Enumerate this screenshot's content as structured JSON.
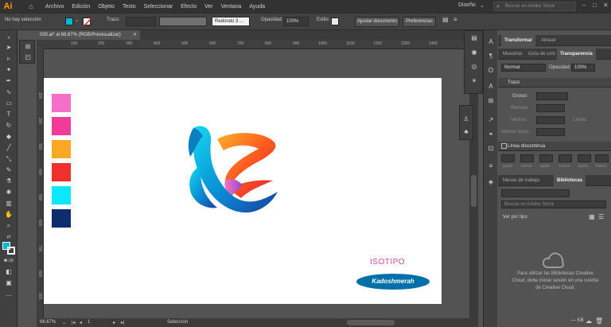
{
  "menubar": {
    "logo": "Ai",
    "home_icon": "home-icon",
    "items": [
      "Archivo",
      "Edición",
      "Objeto",
      "Texto",
      "Seleccionar",
      "Efecto",
      "Ver",
      "Ventana",
      "Ayuda"
    ],
    "workspace": "Diseño",
    "stock_search_placeholder": "Buscar en Adobe Stock",
    "window_minimize": "–",
    "window_maximize": "□",
    "window_close": "✕"
  },
  "controlbar": {
    "selection_status": "No hay selección",
    "stroke_label": "Trazo:",
    "brush_label": "Redondo 3 ...",
    "opacity_label": "Opacidad:",
    "opacity_value": "100%",
    "style_label": "Estilo:",
    "fit_document_button": "Ajustar documento",
    "preferences_button": "Preferencias",
    "fill_color": "#00b7d6"
  },
  "document": {
    "tab_title": "030.ai* al 66,67% (RGB/Previsualizar)",
    "close_icon": "close-icon"
  },
  "rulers": {
    "top_ticks": [
      "100",
      "200",
      "300",
      "400",
      "500",
      "600",
      "700",
      "800",
      "900",
      "1000",
      "1100",
      "1200",
      "1300",
      "1400"
    ],
    "left_ticks": [
      "100",
      "200",
      "300",
      "400",
      "500",
      "600",
      "700",
      "800",
      "900",
      "1000"
    ]
  },
  "artboard": {
    "swatches": [
      "#f56fc8",
      "#f23b98",
      "#f8a824",
      "#f02f2f",
      "#0ee6fa",
      "#0c2d6e"
    ],
    "isotipo_label": "ISOTIPO",
    "brand_name": "Kadoshmerah",
    "brand_color": "#0071a8"
  },
  "statusbar": {
    "zoom": "66,67%",
    "artboard_number": "1",
    "tool_name": "Selección"
  },
  "rightpanel": {
    "tabs_top": [
      "Transformar",
      "Alinear"
    ],
    "tabs_second": [
      "Muestras",
      "Guía de colo",
      "Transparencia"
    ],
    "blend_mode": "Normal",
    "opacity_label": "Opacidad:",
    "opacity_value": "100%",
    "stroke_section": "Trazo",
    "weight_label": "Grosor:",
    "cap_label": "Remate:",
    "corner_label": "Vértice:",
    "limit_label": "Límite:",
    "align_stroke_label": "Alinear trazo:",
    "dashed_label": "Línea discontinua",
    "dash_labels": [
      "guión",
      "hueco",
      "guión",
      "hueco",
      "guión",
      "hueco"
    ],
    "library_tabs": [
      "Mesas de trabajo",
      "Bibliotecas"
    ],
    "library_search_placeholder": "Buscar en Adobe Stock",
    "view_by": "Ver por tipo",
    "cc_message": "Para utilizar las Bibliotecas Creative Cloud, debe iniciar sesión en una cuenta de Creative Cloud.",
    "footer_size": "— KB"
  }
}
